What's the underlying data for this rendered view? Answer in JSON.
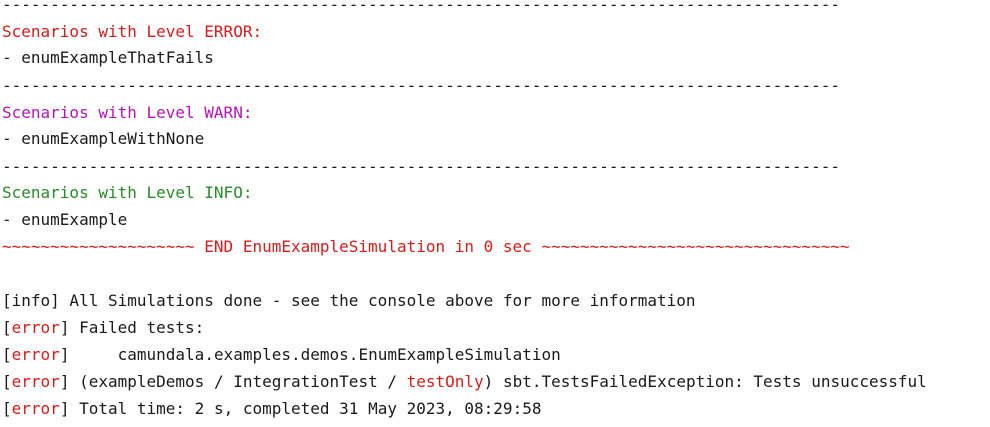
{
  "colors": {
    "error": "#d41c1c",
    "warn": "#b316b3",
    "info": "#2a8a2a",
    "text": "#1a1a1a",
    "background": "#ffffff"
  },
  "separator": "---------------------------------------------------------------------------------------",
  "sections": [
    {
      "heading": "Scenarios with Level ERROR:",
      "item": "- enumExampleThatFails"
    },
    {
      "heading": "Scenarios with Level WARN:",
      "item": "- enumExampleWithNone"
    },
    {
      "heading": "Scenarios with Level INFO:",
      "item": "- enumExample"
    }
  ],
  "banner": "~~~~~~~~~~~~~~~~~~~~ END EnumExampleSimulation in 0 sec ~~~~~~~~~~~~~~~~~~~~~~~~~~~~~~~~",
  "log": {
    "info_tag": "[info]",
    "info_text": " All Simulations done - see the console above for more information",
    "bracket_open": "[",
    "bracket_close": "]",
    "error_word": "error",
    "failed_tests": " Failed tests:",
    "failed_class": "     camundala.examples.demos.EnumExampleSimulation",
    "exception_prefix": " (exampleDemos / IntegrationTest / ",
    "exception_cmd": "testOnly",
    "exception_suffix": ") sbt.TestsFailedException: Tests unsuccessful",
    "total_time": " Total time: 2 s, completed 31 May 2023, 08:29:58"
  }
}
